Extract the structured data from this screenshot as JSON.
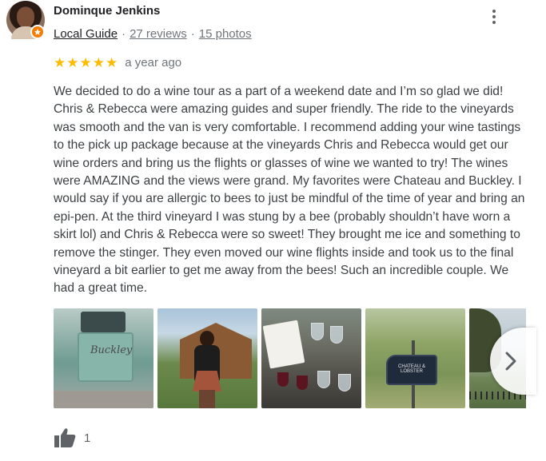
{
  "review": {
    "author_name": "Dominque Jenkins",
    "local_guide_label": "Local Guide",
    "separator": "·",
    "reviews_count_label": "27 reviews",
    "photos_count_label": "15 photos",
    "rating": 5,
    "max_rating": 5,
    "time_ago": "a year ago",
    "text": "We decided to do a wine tour as a part of a weekend date and I’m so glad we did! Chris & Rebecca were amazing guides and super friendly. The ride to the vineyards was smooth and the van is very comfortable. I recommend adding your wine tastings to the pick up package because at the vineyards Chris and Rebecca would get our wine orders and bring us the flights or glasses of wine we wanted to try! The wines were AMAZING and the views were grand. My favorites were Chateau and Buckley. I would say if you are allergic to bees to just be mindful of the time of year and bring an epi-pen. At the third vineyard I was stung by a bee (probably shouldn’t have worn a skirt lol) and Chris & Rebecca were so sweet! They brought me ice and something to remove the stinger. They even moved our wine flights inside and took us to the final vineyard a bit earlier to get me away from the bees! Such an incredible couple. We had a great time.",
    "like_count": "1"
  },
  "photos": {
    "truck_script": "Buckley",
    "sign_text": "CHATEAU & LOBSTER"
  },
  "icons": {
    "star": "star-icon",
    "more": "more-vert-icon",
    "next": "chevron-right-icon",
    "like": "thumb-up-icon",
    "badge": "local-guide-badge-icon"
  },
  "colors": {
    "star": "#fbbc04",
    "badge": "#f57c00",
    "text": "#3c4043",
    "meta": "#70757a"
  }
}
